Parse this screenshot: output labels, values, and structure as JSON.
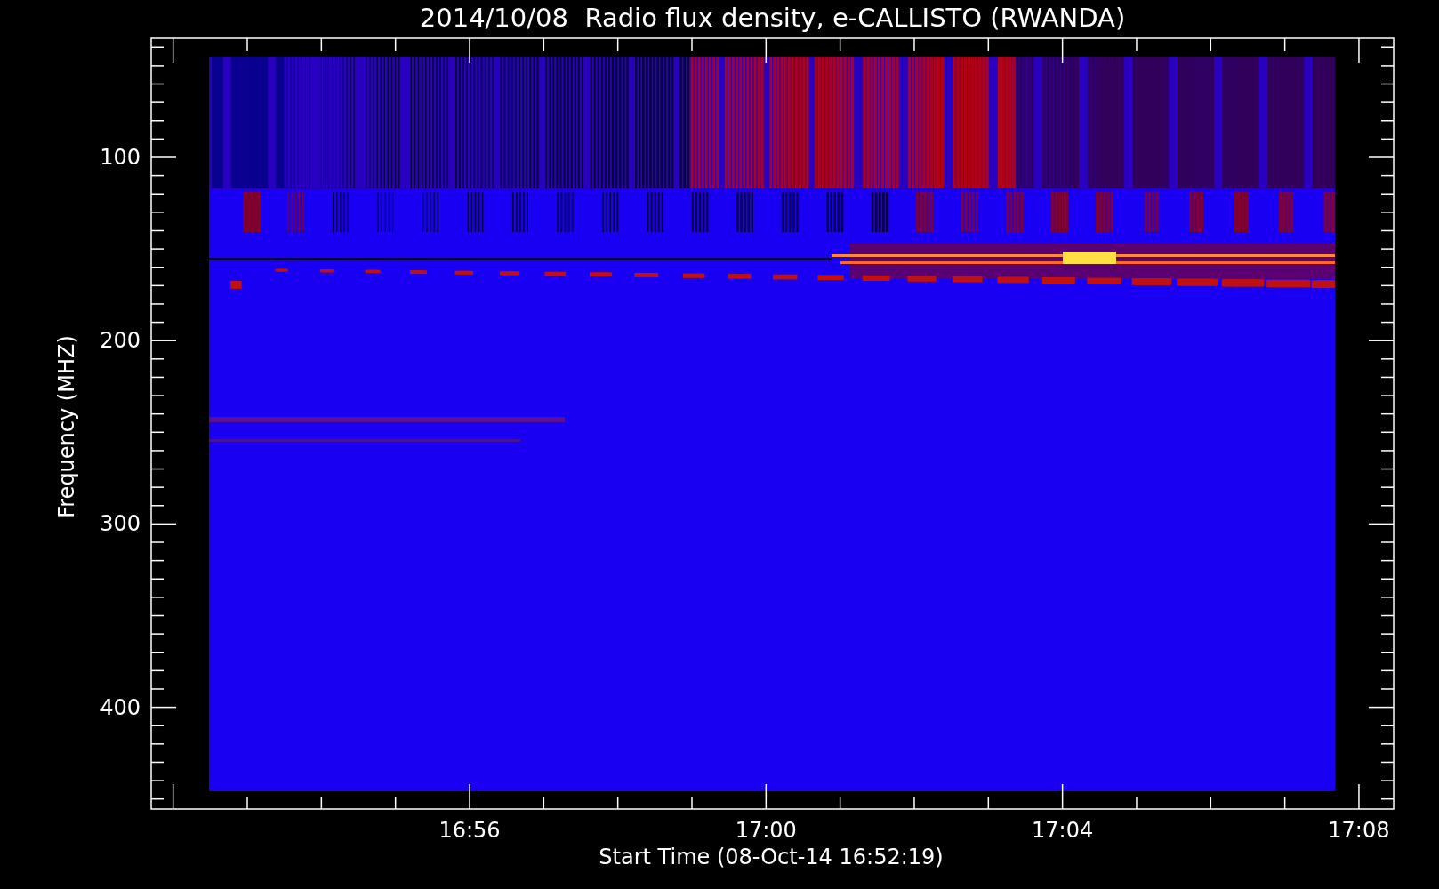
{
  "plot": {
    "title": "2014/10/08  Radio flux density, e-CALLISTO (RWANDA)",
    "ylabel": "Frequency (MHZ)",
    "xlabel": "Start Time (08-Oct-14 16:52:19)",
    "yticks": [
      "100",
      "200",
      "300",
      "400"
    ],
    "xticks": [
      "16:56",
      "17:00",
      "17:04",
      "17:08"
    ]
  }
}
